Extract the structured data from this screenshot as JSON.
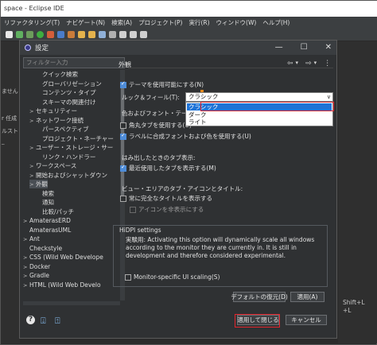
{
  "ide": {
    "title": "space - Eclipse IDE",
    "menu": [
      "リファクタリング(T)",
      "ナビゲート(N)",
      "検索(A)",
      "プロジェクト(P)",
      "実行(R)",
      "ウィンドウ(W)",
      "ヘルプ(H)"
    ],
    "left_strip": [
      "ません",
      "r 任成",
      "ルスト",
      "_"
    ],
    "right_strip": [
      "Shift+L",
      "+L"
    ]
  },
  "dialog": {
    "title": "設定",
    "filter_placeholder": "フィルター入力",
    "tree": [
      {
        "label": "クイック検索",
        "depth": 2,
        "chevron": "",
        "selected": false
      },
      {
        "label": "グローバリゼーション",
        "depth": 2,
        "chevron": "",
        "selected": false
      },
      {
        "label": "コンテンツ・タイプ",
        "depth": 2,
        "chevron": "",
        "selected": false
      },
      {
        "label": "スキーマの関連付け",
        "depth": 2,
        "chevron": "",
        "selected": false
      },
      {
        "label": "セキュリティー",
        "depth": 1,
        "chevron": ">",
        "selected": false
      },
      {
        "label": "ネットワーク接続",
        "depth": 1,
        "chevron": ">",
        "selected": false
      },
      {
        "label": "パースペクティブ",
        "depth": 2,
        "chevron": "",
        "selected": false
      },
      {
        "label": "プロジェクト・ネーチャー",
        "depth": 2,
        "chevron": "",
        "selected": false
      },
      {
        "label": "ユーザー・ストレージ・サー",
        "depth": 1,
        "chevron": ">",
        "selected": false
      },
      {
        "label": "リンク・ハンドラー",
        "depth": 2,
        "chevron": "",
        "selected": false
      },
      {
        "label": "ワークスペース",
        "depth": 1,
        "chevron": ">",
        "selected": false
      },
      {
        "label": "開始およびシャットダウン",
        "depth": 1,
        "chevron": ">",
        "selected": false
      },
      {
        "label": "外観",
        "depth": 1,
        "chevron": ">",
        "selected": true
      },
      {
        "label": "検索",
        "depth": 2,
        "chevron": "",
        "selected": false
      },
      {
        "label": "通知",
        "depth": 2,
        "chevron": "",
        "selected": false
      },
      {
        "label": "比較/パッチ",
        "depth": 2,
        "chevron": "",
        "selected": false
      },
      {
        "label": "AmaterasERD",
        "depth": 0,
        "chevron": ">",
        "selected": false
      },
      {
        "label": "AmaterasUML",
        "depth": 0,
        "chevron": "",
        "selected": false
      },
      {
        "label": "Ant",
        "depth": 0,
        "chevron": ">",
        "selected": false
      },
      {
        "label": "Checkstyle",
        "depth": 0,
        "chevron": "",
        "selected": false
      },
      {
        "label": "CSS (Wild Web Develope",
        "depth": 0,
        "chevron": ">",
        "selected": false
      },
      {
        "label": "Docker",
        "depth": 0,
        "chevron": ">",
        "selected": false
      },
      {
        "label": "Gradle",
        "depth": 0,
        "chevron": ">",
        "selected": false
      },
      {
        "label": "HTML (Wild Web Develo",
        "depth": 0,
        "chevron": ">",
        "selected": false
      }
    ],
    "page": {
      "title": "外観",
      "enable_theming": {
        "label": "テーマを使用可能にする(N)",
        "checked": true
      },
      "look_feel_label": "ルック＆フィール(T):",
      "theme_value": "クラシック",
      "theme_options": [
        {
          "label": "クラシック",
          "selected": true
        },
        {
          "label": "ダーク",
          "selected": false
        },
        {
          "label": "ライト",
          "selected": false
        }
      ],
      "color_theme_label": "色およびフォント・テーマ(C):",
      "round_tabs": {
        "label": "角丸タブを使用する(U)",
        "checked": false
      },
      "mix_fonts": {
        "label": "ラベルに合成フォントおよび色を使用する(U)",
        "checked": true
      },
      "overflow_header": "はみ出したときのタブ表示:",
      "recent_tabs": {
        "label": "最近使用したタブを表示する(M)",
        "checked": true
      },
      "view_header": "ビュー・エリアのタブ・アイコンとタイトル:",
      "full_titles": {
        "label": "常に完全なタイトルを表示する",
        "checked": false
      },
      "hide_icons": {
        "label": "アイコンを非表示にする",
        "checked": false,
        "disabled": true
      },
      "hidpi": {
        "title": "HiDPI settings",
        "description": "実験用: Activating this option will dynamically scale all windows according to the monitor they are currently in. It is still in development and therefore considered experimental.",
        "monitor_scaling": {
          "label": "Monitor-specific UI scaling(S)",
          "checked": false
        }
      },
      "restore_defaults": "デフォルトの復元(D)",
      "apply": "適用(A)"
    },
    "apply_close": "適用して閉じる",
    "cancel": "キャンセル"
  },
  "colors": {
    "accent": "#1e73d6",
    "highlight": "#e4262e"
  }
}
